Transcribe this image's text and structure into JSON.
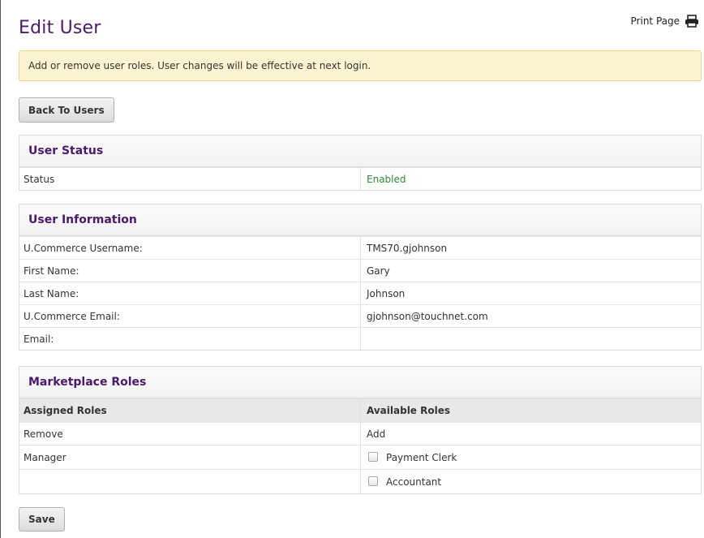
{
  "header": {
    "title": "Edit User",
    "print_label": "Print Page"
  },
  "alert": {
    "message": "Add or remove user roles. User changes will be effective at next login."
  },
  "buttons": {
    "back": "Back To Users",
    "save": "Save"
  },
  "user_status": {
    "title": "User Status",
    "rows": [
      {
        "label": "Status",
        "value": "Enabled"
      }
    ]
  },
  "user_info": {
    "title": "User Information",
    "rows": [
      {
        "label": "U.Commerce Username:",
        "value": "TMS70.gjohnson"
      },
      {
        "label": "First Name:",
        "value": "Gary"
      },
      {
        "label": "Last Name:",
        "value": "Johnson"
      },
      {
        "label": "U.Commerce Email:",
        "value": "gjohnson@touchnet.com"
      },
      {
        "label": "Email:",
        "value": ""
      }
    ]
  },
  "roles": {
    "title": "Marketplace Roles",
    "assigned_header": "Assigned Roles",
    "available_header": "Available Roles",
    "remove_label": "Remove",
    "add_label": "Add",
    "assigned": [
      "Manager",
      ""
    ],
    "available": [
      {
        "label": "Payment Clerk",
        "checked": false
      },
      {
        "label": "Accountant",
        "checked": false
      }
    ]
  },
  "colors": {
    "title_purple": "#4b1a6b",
    "enabled_green": "#2e8b2e",
    "alert_bg": "#fcf3d1"
  },
  "icons": {
    "print": "printer-icon"
  }
}
